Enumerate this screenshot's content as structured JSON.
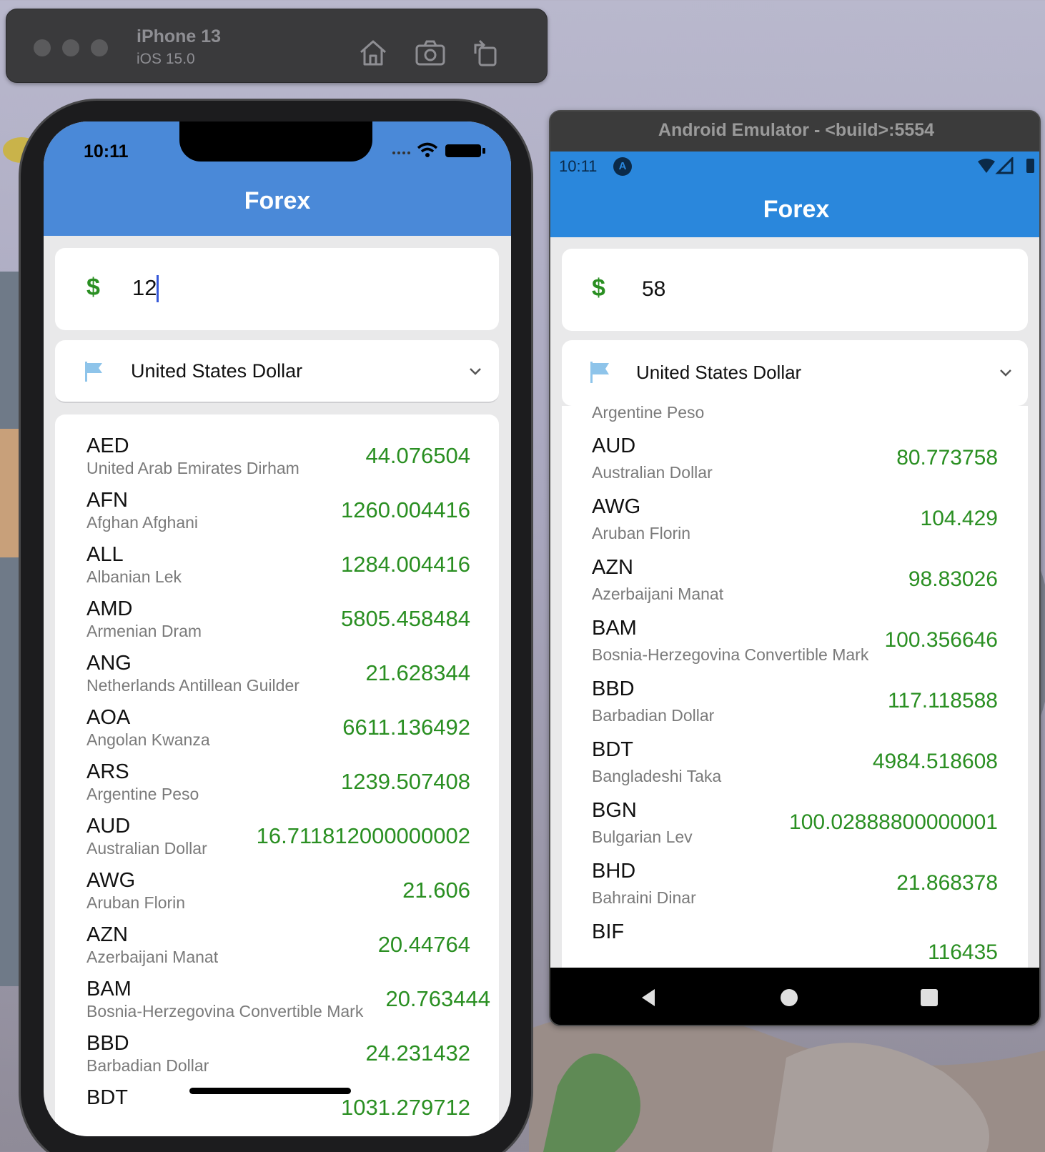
{
  "ios_simulator": {
    "device_name": "iPhone 13",
    "os_version": "iOS 15.0",
    "toolbar_icons": [
      "home-icon",
      "screenshot-icon",
      "rotate-icon"
    ],
    "status_time": "10:11",
    "app_title": "Forex",
    "amount_prefix": "$",
    "amount_value": "12",
    "currency_select": "United States Dollar",
    "rates": [
      {
        "code": "AED",
        "name": "United Arab Emirates Dirham",
        "value": "44.076504"
      },
      {
        "code": "AFN",
        "name": "Afghan Afghani",
        "value": "1260.004416"
      },
      {
        "code": "ALL",
        "name": "Albanian Lek",
        "value": "1284.004416"
      },
      {
        "code": "AMD",
        "name": "Armenian Dram",
        "value": "5805.458484"
      },
      {
        "code": "ANG",
        "name": "Netherlands Antillean Guilder",
        "value": "21.628344"
      },
      {
        "code": "AOA",
        "name": "Angolan Kwanza",
        "value": "6611.136492"
      },
      {
        "code": "ARS",
        "name": "Argentine Peso",
        "value": "1239.507408"
      },
      {
        "code": "AUD",
        "name": "Australian Dollar",
        "value": "16.711812000000002"
      },
      {
        "code": "AWG",
        "name": "Aruban Florin",
        "value": "21.606"
      },
      {
        "code": "AZN",
        "name": "Azerbaijani Manat",
        "value": "20.44764"
      },
      {
        "code": "BAM",
        "name": "Bosnia-Herzegovina Convertible Mark",
        "value": "20.763444"
      },
      {
        "code": "BBD",
        "name": "Barbadian Dollar",
        "value": "24.231432"
      },
      {
        "code": "BDT",
        "name": "",
        "value": "1031.279712"
      }
    ]
  },
  "android_emulator": {
    "window_title": "Android Emulator - <build>:5554",
    "status_time": "10:11",
    "status_badge": "A",
    "app_title": "Forex",
    "amount_prefix": "$",
    "amount_value": "58",
    "currency_select": "United States Dollar",
    "partial_top_name": "Argentine Peso",
    "rates": [
      {
        "code": "AUD",
        "name": "Australian Dollar",
        "value": "80.773758"
      },
      {
        "code": "AWG",
        "name": "Aruban Florin",
        "value": "104.429"
      },
      {
        "code": "AZN",
        "name": "Azerbaijani Manat",
        "value": "98.83026"
      },
      {
        "code": "BAM",
        "name": "Bosnia-Herzegovina Convertible Mark",
        "value": "100.356646"
      },
      {
        "code": "BBD",
        "name": "Barbadian Dollar",
        "value": "117.118588"
      },
      {
        "code": "BDT",
        "name": "Bangladeshi Taka",
        "value": "4984.518608"
      },
      {
        "code": "BGN",
        "name": "Bulgarian Lev",
        "value": "100.02888800000001"
      },
      {
        "code": "BHD",
        "name": "Bahraini Dinar",
        "value": "21.868378"
      },
      {
        "code": "BIF",
        "name": "",
        "value": "116435"
      }
    ],
    "nav_buttons": [
      "back-icon",
      "home-icon",
      "recents-icon"
    ]
  },
  "colors": {
    "ios_header": "#4a89d8",
    "android_header": "#2a87dc",
    "rate_value": "#2a8f22",
    "currency_name": "#7a7a7a"
  }
}
